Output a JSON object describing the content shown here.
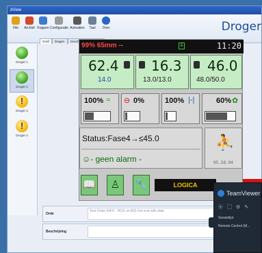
{
  "window": {
    "title": "dView"
  },
  "header": {
    "title": "Droger"
  },
  "toolbar": {
    "buttons": [
      {
        "label": "File",
        "color": "#e0a317"
      },
      {
        "label": "Archief",
        "color": "#d24b2b"
      },
      {
        "label": "Koppen",
        "color": "#3e7bd0"
      },
      {
        "label": "Configuratie",
        "color": "#9b9b9b"
      },
      {
        "label": "Activaties",
        "color": "#5a5a5a"
      },
      {
        "label": "Taal",
        "color": "#6a7f9a"
      },
      {
        "label": "Over",
        "color": "#2a64c5"
      }
    ]
  },
  "sidebar": {
    "items": [
      {
        "label": "Droger 1",
        "state": "ok"
      },
      {
        "label": "Droger 2",
        "state": "ok"
      },
      {
        "label": "Droger 3",
        "state": "warn"
      },
      {
        "label": "Droger 4",
        "state": "warn"
      }
    ]
  },
  "tabs": [
    "Grafi",
    "Dragen",
    "Geschiedenis",
    "alarm"
  ],
  "panel": {
    "statusbar": {
      "left": "99% 65mm --",
      "mid": "A",
      "time": "11:20"
    },
    "gauges": [
      {
        "main": "62.4",
        "sub": "14.0"
      },
      {
        "main": "16.3",
        "sub": "13.0/13.0"
      },
      {
        "main": "46.0",
        "sub": "48.0/50.0"
      }
    ],
    "cells": [
      {
        "pct": "100%",
        "icon": "≈",
        "fill": 0.35
      },
      {
        "pct": "0%",
        "icon": "⊖",
        "fill": 0.15
      },
      {
        "pct": "100%",
        "icon": "|-|",
        "fill": 0.2
      },
      {
        "pct": "60%",
        "icon": "✿",
        "fill": 0.7
      }
    ],
    "status_line": "Status:Fase4→≤45.0",
    "alarm_line": "☺- geen alarm -",
    "timestamp": "95.58.04",
    "logo": "LOGICA"
  },
  "bottom": {
    "rows": [
      {
        "label": "Orde",
        "value": "Test Order INFO - BOX on BIG Dot end with date"
      },
      {
        "label": "Beschrijving",
        "value": ""
      }
    ]
  },
  "teamviewer": {
    "title": "TeamViewer",
    "controls": "⦿ ▢ ⚙ ✎",
    "lines": [
      "Sessielijst",
      "Remote Control (M..."
    ]
  }
}
